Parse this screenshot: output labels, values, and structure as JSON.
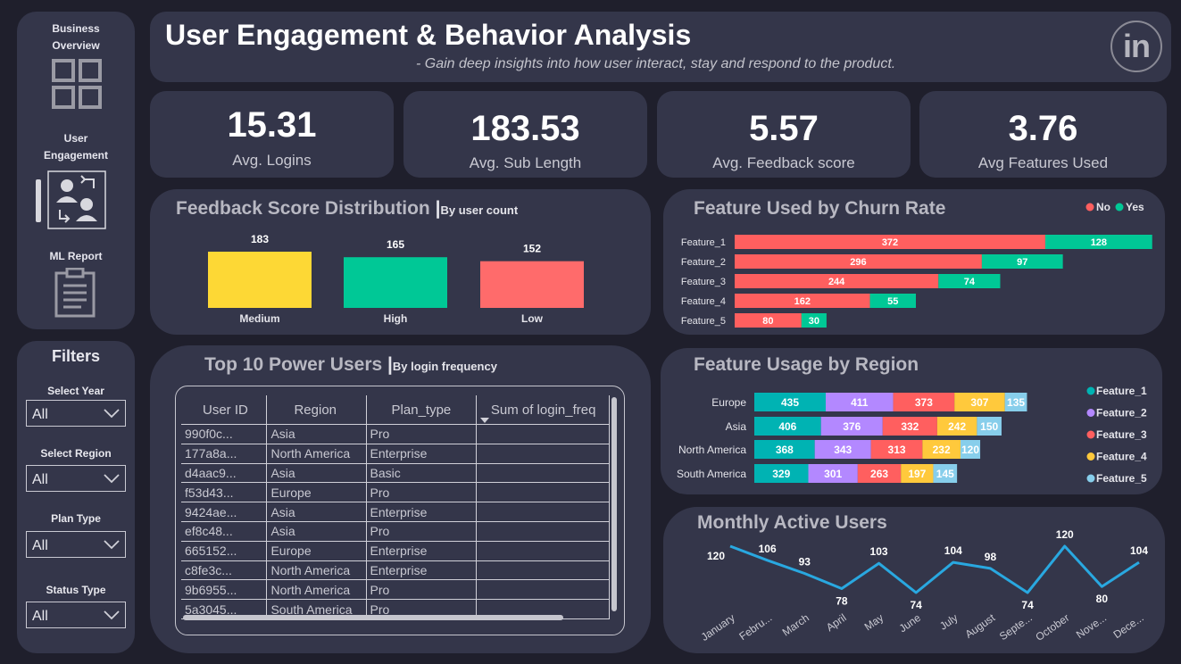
{
  "nav": {
    "items": [
      {
        "label_line1": "Business",
        "label_line2": "Overview",
        "icon": "grid-icon"
      },
      {
        "label_line1": "User",
        "label_line2": "Engagement",
        "icon": "users-exchange-icon"
      },
      {
        "label_line1": "ML Report",
        "label_line2": "",
        "icon": "clipboard-icon"
      }
    ]
  },
  "filters": {
    "title": "Filters",
    "year": {
      "label": "Select Year",
      "value": "All"
    },
    "region": {
      "label": "Select Region",
      "value": "All"
    },
    "plan": {
      "label": "Plan Type",
      "value": "All"
    },
    "status": {
      "label": "Status Type",
      "value": "All"
    }
  },
  "header": {
    "title": "User Engagement & Behavior Analysis",
    "subtitle": "- Gain deep insights into how user interact, stay and respond to the product.",
    "logo_text": "in"
  },
  "kpis": [
    {
      "value": "15.31",
      "label": "Avg. Logins"
    },
    {
      "value": "183.53",
      "label": "Avg. Sub Length"
    },
    {
      "value": "5.57",
      "label": "Avg. Feedback score"
    },
    {
      "value": "3.76",
      "label": "Avg Features Used"
    }
  ],
  "feedback_card": {
    "title": "Feedback Score Distribution",
    "subtitle": "By user count"
  },
  "churn_card": {
    "title": "Feature Used by Churn Rate",
    "legend": [
      "No",
      "Yes"
    ]
  },
  "region_card": {
    "title": "Feature Usage by Region"
  },
  "mau_card": {
    "title": "Monthly Active Users"
  },
  "power_users": {
    "title": "Top 10 Power Users",
    "subtitle": "By login frequency",
    "columns": [
      "User ID",
      "Region",
      "Plan_type",
      "Sum of login_freq"
    ],
    "rows": [
      [
        "990f0c...",
        "Asia",
        "Pro",
        ""
      ],
      [
        "177a8a...",
        "North America",
        "Enterprise",
        ""
      ],
      [
        "d4aac9...",
        "Asia",
        "Basic",
        ""
      ],
      [
        "f53d43...",
        "Europe",
        "Pro",
        ""
      ],
      [
        "9424ae...",
        "Asia",
        "Enterprise",
        ""
      ],
      [
        "ef8c48...",
        "Asia",
        "Pro",
        ""
      ],
      [
        "665152...",
        "Europe",
        "Enterprise",
        ""
      ],
      [
        "c8fe3c...",
        "North America",
        "Enterprise",
        ""
      ],
      [
        "9b6955...",
        "North America",
        "Pro",
        ""
      ],
      [
        "5a3045...",
        "South America",
        "Pro",
        ""
      ]
    ]
  },
  "colors": {
    "background": "#1f1f2c",
    "panel": "#34364a",
    "yellow": "#fdd835",
    "teal": "#00c896",
    "coral": "#ff6b6b",
    "cyan": "#00b3b3",
    "purple": "#b388ff",
    "red": "#ff5f5f",
    "orange": "#ffc93c",
    "light_blue": "#87ceeb",
    "line": "#29a8e0"
  },
  "chart_data": [
    {
      "type": "bar",
      "title": "Feedback Score Distribution",
      "categories": [
        "Medium",
        "High",
        "Low"
      ],
      "values": [
        183,
        165,
        152
      ],
      "colors": [
        "#fdd835",
        "#00c896",
        "#ff6b6b"
      ]
    },
    {
      "type": "bar",
      "orientation": "horizontal",
      "stacked": true,
      "title": "Feature Used by Churn Rate",
      "categories": [
        "Feature_1",
        "Feature_2",
        "Feature_3",
        "Feature_4",
        "Feature_5"
      ],
      "series": [
        {
          "name": "No",
          "values": [
            372,
            296,
            244,
            162,
            80
          ],
          "color": "#ff5f5f"
        },
        {
          "name": "Yes",
          "values": [
            128,
            97,
            74,
            55,
            30
          ],
          "color": "#00c896"
        }
      ],
      "legend": "top-right"
    },
    {
      "type": "bar",
      "orientation": "horizontal",
      "stacked": true,
      "title": "Feature Usage by Region",
      "categories": [
        "Europe",
        "Asia",
        "North America",
        "South America"
      ],
      "series": [
        {
          "name": "Feature_1",
          "values": [
            435,
            406,
            368,
            329
          ],
          "color": "#00b3b3"
        },
        {
          "name": "Feature_2",
          "values": [
            411,
            376,
            343,
            301
          ],
          "color": "#b388ff"
        },
        {
          "name": "Feature_3",
          "values": [
            373,
            332,
            313,
            263
          ],
          "color": "#ff5f5f"
        },
        {
          "name": "Feature_4",
          "values": [
            307,
            242,
            232,
            197
          ],
          "color": "#ffc93c"
        },
        {
          "name": "Feature_5",
          "values": [
            135,
            150,
            120,
            145
          ],
          "color": "#87ceeb"
        }
      ],
      "legend": "right"
    },
    {
      "type": "line",
      "title": "Monthly Active Users",
      "categories": [
        "January",
        "Febru...",
        "March",
        "April",
        "May",
        "June",
        "July",
        "August",
        "Septe...",
        "October",
        "Nove...",
        "Dece..."
      ],
      "values": [
        120,
        106,
        93,
        78,
        103,
        74,
        104,
        98,
        74,
        120,
        80,
        104
      ],
      "color": "#29a8e0"
    }
  ]
}
